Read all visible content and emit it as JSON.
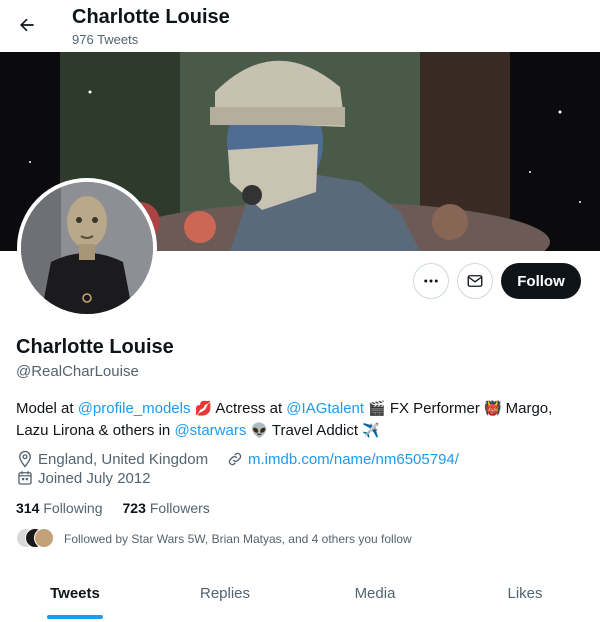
{
  "header": {
    "name": "Charlotte Louise",
    "tweet_count": "976 Tweets"
  },
  "profile": {
    "name": "Charlotte Louise",
    "handle": "@RealCharLouise",
    "follow_label": "Follow",
    "bio": {
      "t1": "Model at ",
      "link1": "@profile_models",
      "t2": " Actress at ",
      "link2": "@IAGtalent",
      "t3": " FX Performer ",
      "t4": " Margo, Lazu Lirona & others in ",
      "link3": "@starwars",
      "t5": " Travel Addict "
    },
    "emojis": {
      "lips": "💋",
      "clapper": "🎬",
      "ogre": "👹",
      "alien": "👽",
      "plane": "✈️"
    },
    "location": "England, United Kingdom",
    "website": "m.imdb.com/name/nm6505794/",
    "joined": "Joined July 2012",
    "following_count": "314",
    "following_label": "Following",
    "followers_count": "723",
    "followers_label": "Followers",
    "followed_by": "Followed by Star Wars 5W, Brian Matyas, and 4 others you follow"
  },
  "tabs": [
    {
      "label": "Tweets",
      "active": true
    },
    {
      "label": "Replies",
      "active": false
    },
    {
      "label": "Media",
      "active": false
    },
    {
      "label": "Likes",
      "active": false
    }
  ],
  "colors": {
    "accent": "#1d9bf0",
    "text": "#0f1419",
    "muted": "#536471",
    "button_dark": "#0f1419"
  }
}
